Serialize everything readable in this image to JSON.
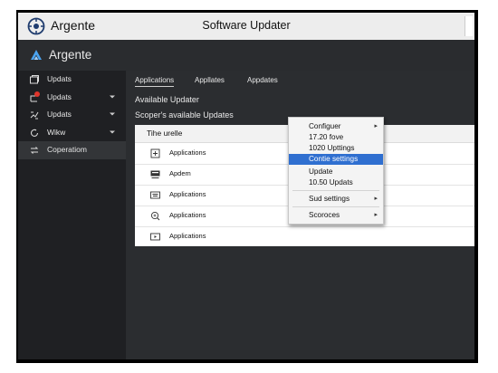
{
  "window": {
    "app_name": "Argente",
    "title": "Software Updater"
  },
  "header": {
    "brand": "Argente"
  },
  "sidebar": {
    "items": [
      {
        "label": "Updats",
        "icon": "window-icon"
      },
      {
        "label": "Updats",
        "icon": "update-badge-icon"
      },
      {
        "label": "Updats",
        "icon": "sync-icon"
      },
      {
        "label": "Wikw",
        "icon": "refresh-icon"
      },
      {
        "label": "Coperatiom",
        "icon": "swap-icon"
      }
    ]
  },
  "main": {
    "tabs": [
      {
        "label": "Applications"
      },
      {
        "label": "Appllates"
      },
      {
        "label": "Appdates"
      }
    ],
    "section_title": "Available Updater",
    "section_subtitle": "Scoper's available Updates",
    "table": {
      "header": "Tihe urelle",
      "rows": [
        {
          "label": "Applications",
          "icon": "square-plus-icon"
        },
        {
          "label": "Apdem",
          "icon": "monitor-icon"
        },
        {
          "label": "Applications",
          "icon": "keyboard-icon"
        },
        {
          "label": "Applications",
          "icon": "search-icon"
        },
        {
          "label": "Applications",
          "icon": "play-box-icon"
        }
      ]
    }
  },
  "context_menu": {
    "items": [
      {
        "label": "Configuer",
        "has_submenu": true
      },
      {
        "label": "17.20 fove",
        "has_submenu": false
      },
      {
        "label": "1020 Upttings",
        "has_submenu": false
      },
      {
        "label": "Contie settings",
        "has_submenu": false,
        "highlighted": true
      },
      {
        "label": "Update",
        "has_submenu": false
      },
      {
        "label": "10.50 Updats",
        "has_submenu": false
      },
      {
        "label": "Sud settings",
        "has_submenu": true
      },
      {
        "label": "Scoroces",
        "has_submenu": true
      }
    ],
    "submenu_arrow": "▸"
  },
  "colors": {
    "accent": "#2f6fd0",
    "sidebar_bg": "#1f2023",
    "main_bg": "#2b2d30",
    "badge": "#e0352b"
  }
}
